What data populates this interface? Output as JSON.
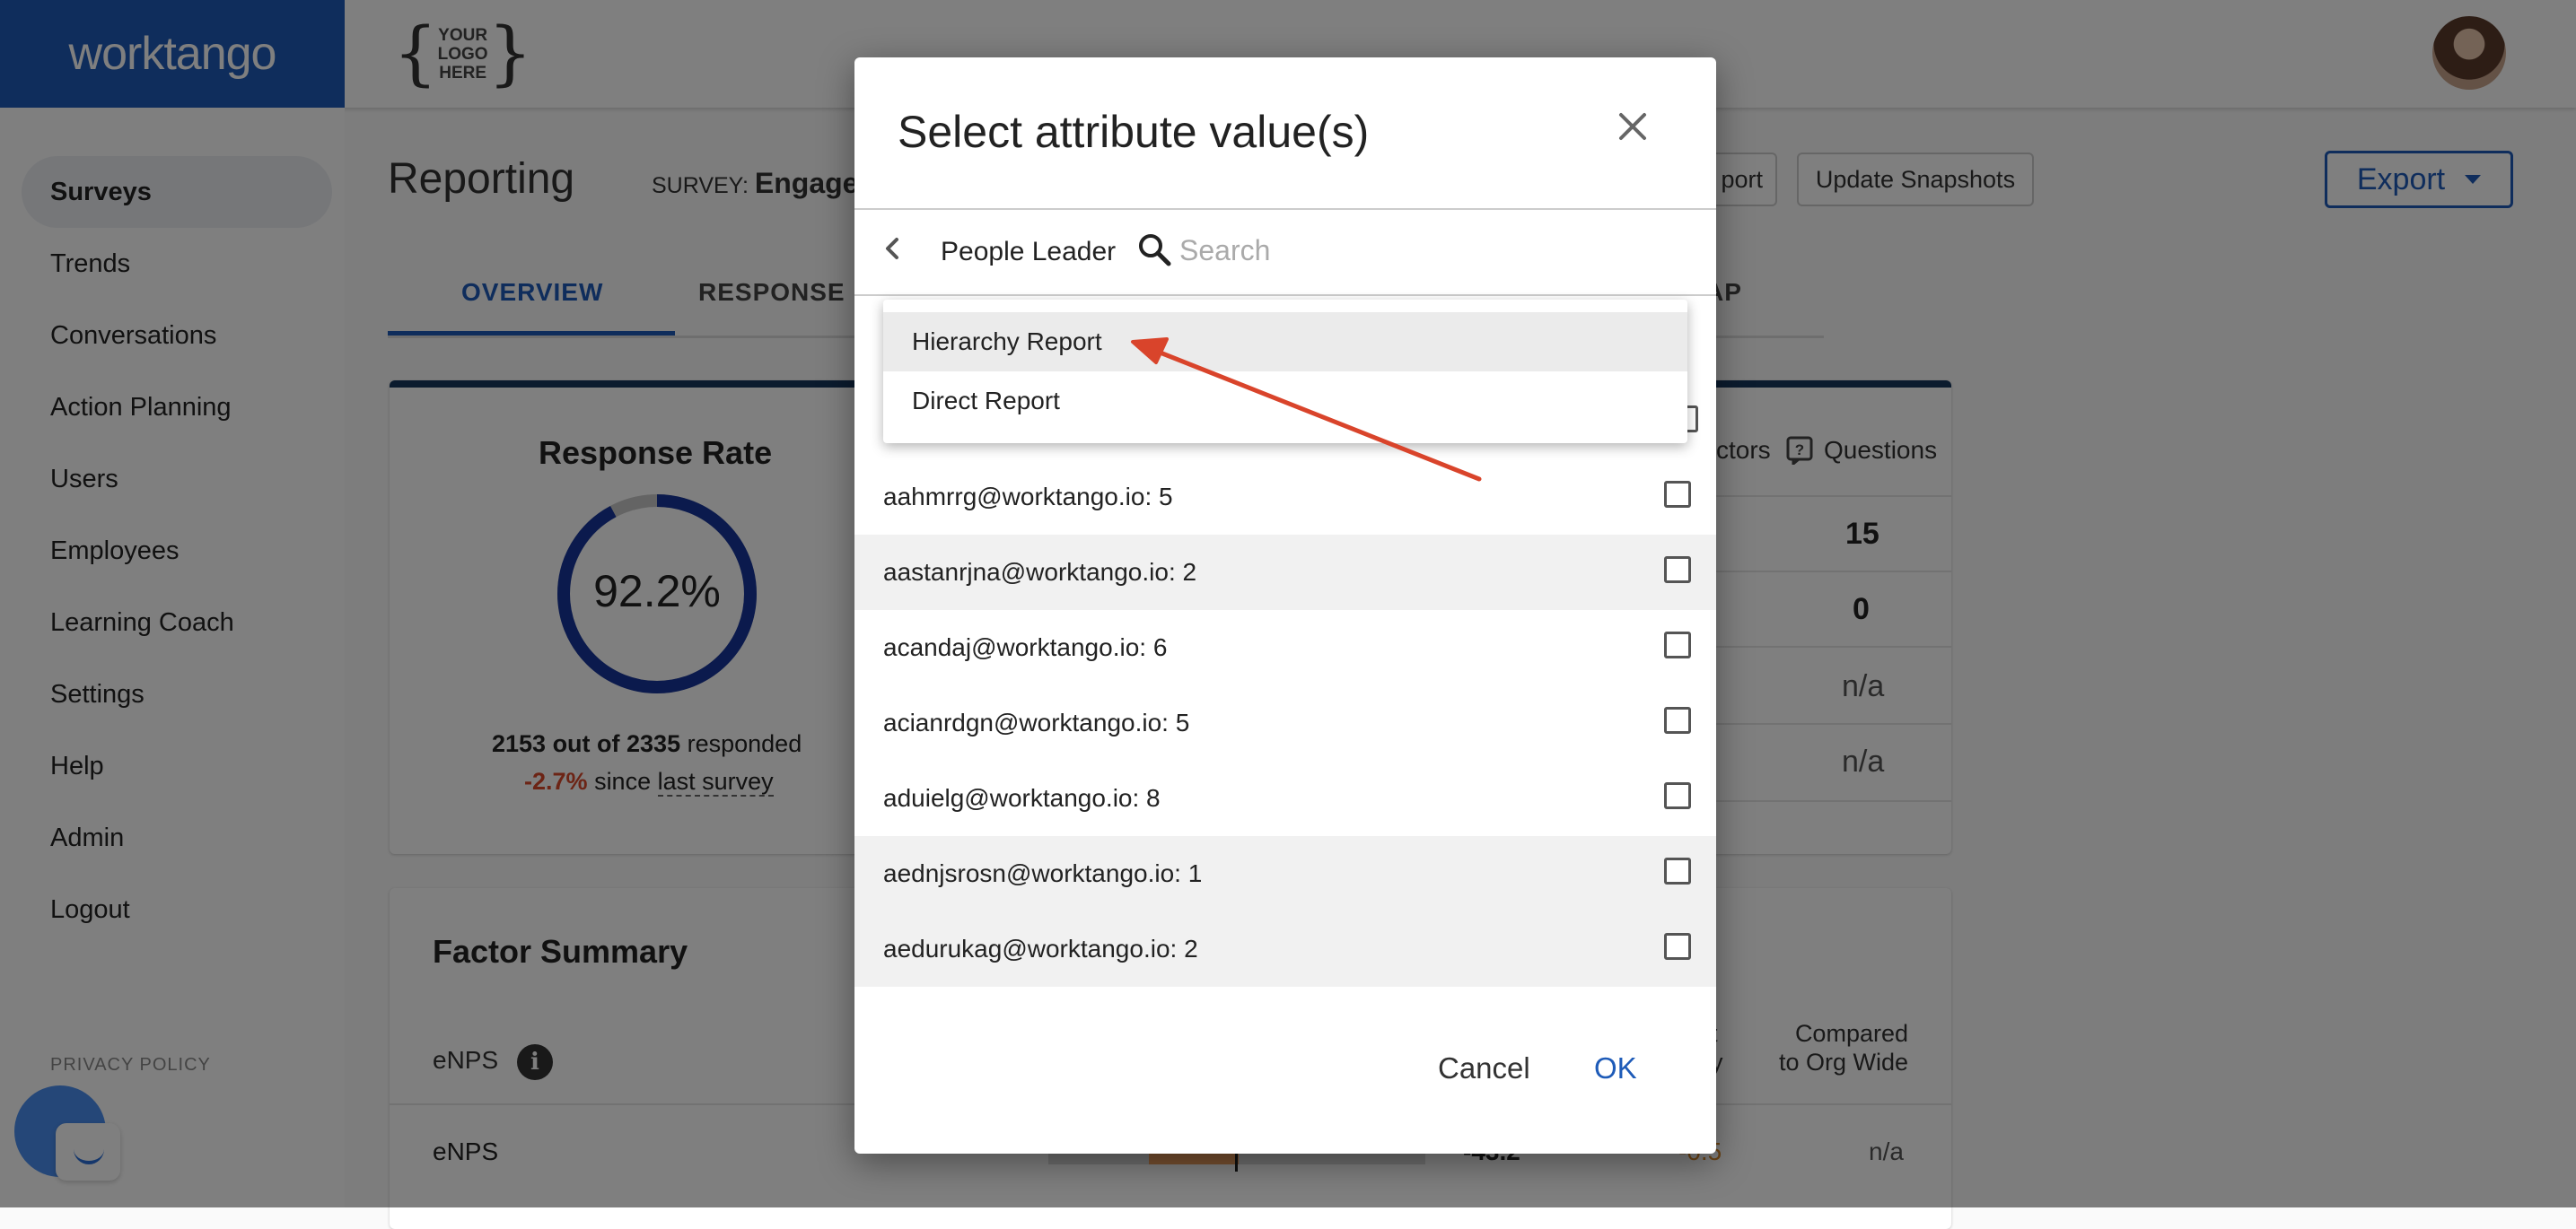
{
  "brand": "worktango",
  "logo_placeholder": "YOUR LOGO HERE",
  "logo_lines": [
    "YOUR",
    "LOGO",
    "HERE"
  ],
  "sidebar": {
    "items": [
      {
        "label": "Surveys",
        "active": true
      },
      {
        "label": "Trends"
      },
      {
        "label": "Conversations"
      },
      {
        "label": "Action Planning"
      },
      {
        "label": "Users"
      },
      {
        "label": "Employees"
      },
      {
        "label": "Learning Coach"
      },
      {
        "label": "Settings"
      },
      {
        "label": "Help"
      },
      {
        "label": "Admin"
      },
      {
        "label": "Logout"
      }
    ],
    "privacy_policy": "PRIVACY POLICY"
  },
  "header": {
    "title": "Reporting",
    "survey_label": "SURVEY:",
    "survey_name": "Engage",
    "report_btn_partial": "port",
    "update_snapshots": "Update Snapshots",
    "export": "Export"
  },
  "tabs": [
    {
      "label": "OVERVIEW",
      "active": true
    },
    {
      "label": "RESPONSE"
    },
    {
      "label": "AP"
    }
  ],
  "response_rate": {
    "title": "Response Rate",
    "value": "92.2%",
    "fraction": 0.922,
    "responded_count": "2153 out of 2335",
    "responded_suffix": "responded",
    "change": "-2.7%",
    "since": "since",
    "since_link": "last survey"
  },
  "right_panel": {
    "factors_partial": "ctors",
    "questions": "Questions",
    "values": [
      "15",
      "0",
      "n/a",
      "n/a"
    ],
    "row_chars": [
      ",",
      ","
    ]
  },
  "factor_summary": {
    "title": "Factor Summary",
    "enps_header": "eNPS",
    "info_icon": "i",
    "col_partial": [
      "t",
      "y"
    ],
    "compared_line1": "Compared",
    "compared_line2": "to Org Wide",
    "row_label": "eNPS",
    "row_value": "-43.2",
    "row_change": "-0.5",
    "row_compare": "n/a"
  },
  "modal": {
    "title": "Select attribute value(s)",
    "breadcrumb": "People Leader",
    "search_placeholder": "Search",
    "dropdown": [
      "Hierarchy Report",
      "Direct Report"
    ],
    "list": [
      {
        "label": "aahmrrg@worktango.io: 5",
        "checked": false
      },
      {
        "label": "aastanrjna@worktango.io: 2",
        "checked": false
      },
      {
        "label": "acandaj@worktango.io: 6",
        "checked": false
      },
      {
        "label": "acianrdgn@worktango.io: 5",
        "checked": false
      },
      {
        "label": "aduielg@worktango.io: 8",
        "checked": false
      },
      {
        "label": "aednjsrosn@worktango.io: 1",
        "checked": false
      },
      {
        "label": "aedurukag@worktango.io: 2",
        "checked": false
      }
    ],
    "cancel": "Cancel",
    "ok": "OK"
  },
  "colors": {
    "brand_blue": "#1e5bb8",
    "negative": "#d9482b",
    "annotation_arrow": "#d9442b"
  }
}
